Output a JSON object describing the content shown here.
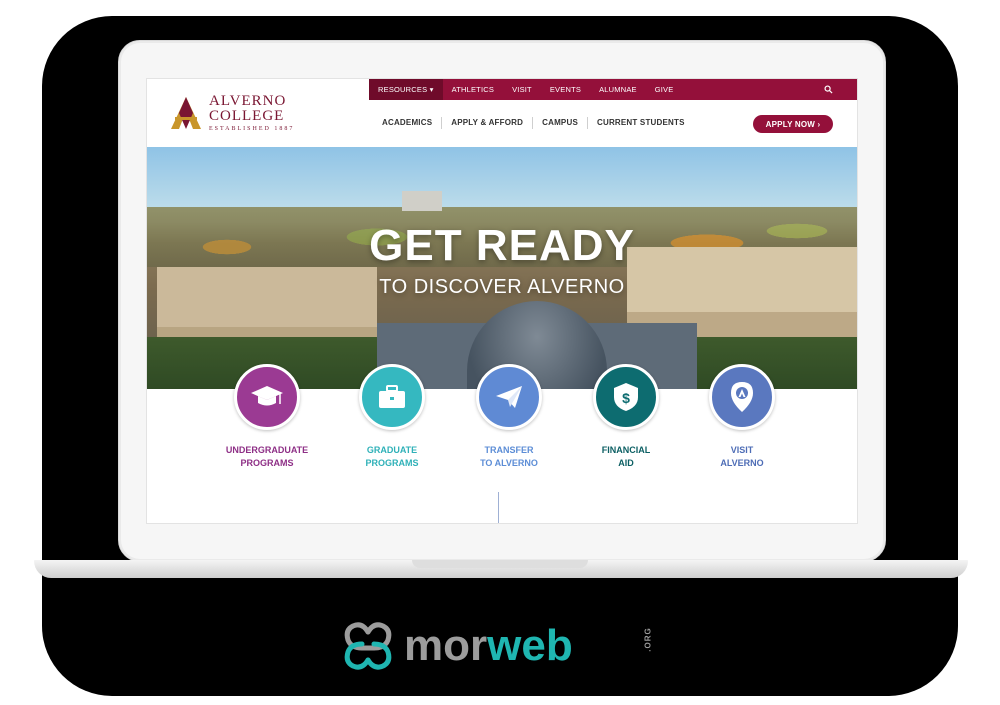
{
  "site": {
    "logo": {
      "line1": "ALVERNO",
      "line2": "COLLEGE",
      "line3": "ESTABLISHED 1887"
    },
    "topbar": {
      "items": [
        "RESOURCES ▾",
        "ATHLETICS",
        "VISIT",
        "EVENTS",
        "ALUMNAE",
        "GIVE"
      ],
      "search_icon": "search-icon"
    },
    "mainnav": {
      "items": [
        "ACADEMICS",
        "APPLY & AFFORD",
        "CAMPUS",
        "CURRENT STUDENTS"
      ]
    },
    "apply_button": "APPLY NOW ›",
    "hero": {
      "title": "GET READY",
      "subtitle": "TO DISCOVER ALVERNO"
    },
    "quicklinks": [
      {
        "line1": "UNDERGRADUATE",
        "line2": "PROGRAMS",
        "icon": "graduation-cap-icon",
        "color": "#9b3a93",
        "label_color": "#8e2f86"
      },
      {
        "line1": "GRADUATE",
        "line2": "PROGRAMS",
        "icon": "briefcase-icon",
        "color": "#35b8c0",
        "label_color": "#2fb1b8"
      },
      {
        "line1": "TRANSFER",
        "line2": "TO ALVERNO",
        "icon": "paper-plane-icon",
        "color": "#5f8ad4",
        "label_color": "#5c8dd6"
      },
      {
        "line1": "FINANCIAL",
        "line2": "AID",
        "icon": "dollar-shield-icon",
        "color": "#0d6c70",
        "label_color": "#0c5f63"
      },
      {
        "line1": "VISIT",
        "line2": "ALVERNO",
        "icon": "location-pin-icon",
        "color": "#5a78bf",
        "label_color": "#4e6db6"
      }
    ]
  },
  "brand": {
    "mor": "mor",
    "web": "web",
    "org": ".ORG"
  },
  "colors": {
    "primary": "#94103a",
    "brand_teal": "#1fb6b1",
    "brand_gray": "#9c9c9c"
  }
}
